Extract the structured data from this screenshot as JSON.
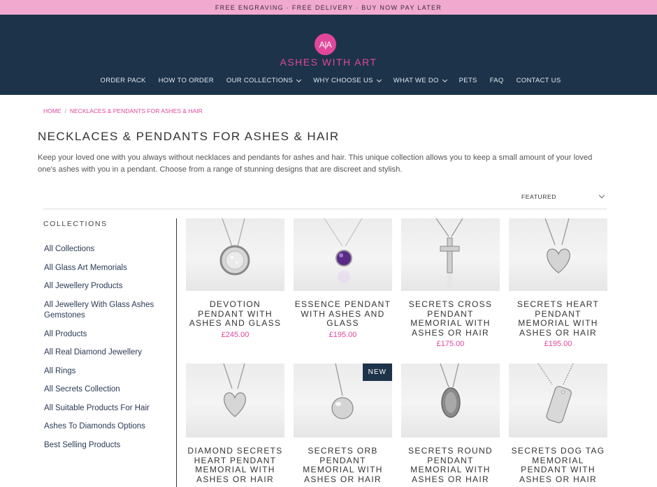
{
  "promo": {
    "text": "FREE ENGRAVING · FREE DELIVERY · BUY NOW PAY LATER"
  },
  "header": {
    "logo_mark": "A|A",
    "logo_text": "ASHES WITH ART",
    "nav": [
      {
        "label": "ORDER PACK",
        "dropdown": false
      },
      {
        "label": "HOW TO ORDER",
        "dropdown": false
      },
      {
        "label": "OUR COLLECTIONS",
        "dropdown": true
      },
      {
        "label": "WHY CHOOSE US",
        "dropdown": true
      },
      {
        "label": "WHAT WE DO",
        "dropdown": true
      },
      {
        "label": "PETS",
        "dropdown": false
      },
      {
        "label": "FAQ",
        "dropdown": false
      },
      {
        "label": "CONTACT US",
        "dropdown": false
      }
    ]
  },
  "breadcrumb": {
    "home": "HOME",
    "separator": "/",
    "current": "NECKLACES & PENDANTS FOR ASHES & HAIR"
  },
  "page": {
    "title": "NECKLACES & PENDANTS FOR ASHES & HAIR",
    "description": "Keep your loved one with you always without necklaces and pendants for ashes and hair. This unique collection allows you to keep a small amount of your loved one's ashes with you in a pendant. Choose from a range of stunning designs that are discreet and stylish."
  },
  "sort": {
    "selected": "FEATURED"
  },
  "sidebar": {
    "title": "COLLECTIONS",
    "items": [
      "All Collections",
      "All Glass Art Memorials",
      "All Jewellery Products",
      "All Jewellery With Glass Ashes Gemstones",
      "All Products",
      "All Real Diamond Jewellery",
      "All Rings",
      "All Secrets Collection",
      "All Suitable Products For Hair",
      "Ashes To Diamonds Options",
      "Best Selling Products"
    ]
  },
  "products": [
    {
      "title": "DEVOTION PENDANT WITH ASHES AND GLASS",
      "price": "£245.00",
      "badge": "",
      "icon": "round-glass-pendant-icon"
    },
    {
      "title": "ESSENCE PENDANT WITH ASHES AND GLASS",
      "price": "£195.00",
      "badge": "",
      "icon": "purple-gem-pendant-icon"
    },
    {
      "title": "SECRETS CROSS PENDANT MEMORIAL WITH ASHES OR HAIR",
      "price": "£175.00",
      "badge": "",
      "icon": "cross-pendant-icon"
    },
    {
      "title": "SECRETS HEART PENDANT MEMORIAL WITH ASHES OR HAIR",
      "price": "£195.00",
      "badge": "",
      "icon": "heart-pendant-icon"
    },
    {
      "title": "DIAMOND SECRETS HEART PENDANT MEMORIAL WITH ASHES OR HAIR",
      "price": "",
      "badge": "",
      "icon": "heart-pendant-icon"
    },
    {
      "title": "SECRETS ORB PENDANT MEMORIAL WITH ASHES OR HAIR",
      "price": "",
      "badge": "NEW",
      "icon": "orb-pendant-icon"
    },
    {
      "title": "SECRETS ROUND PENDANT MEMORIAL WITH ASHES OR HAIR",
      "price": "",
      "badge": "",
      "icon": "round-locket-pendant-icon"
    },
    {
      "title": "SECRETS DOG TAG MEMORIAL PENDANT WITH ASHES OR HAIR",
      "price": "",
      "badge": "",
      "icon": "dog-tag-pendant-icon"
    }
  ],
  "colors": {
    "promo_bg": "#f1a9cf",
    "header_bg": "#1c3349",
    "accent_pink": "#e0479a",
    "text_dark": "#333333"
  }
}
